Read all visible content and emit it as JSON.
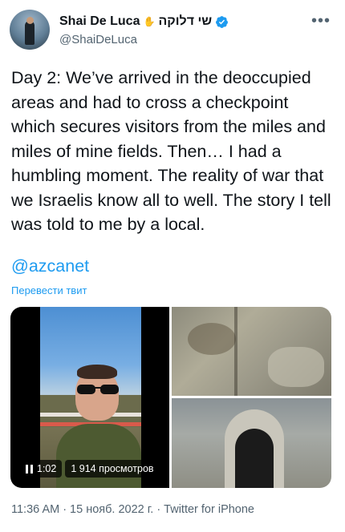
{
  "author": {
    "display_name": "Shai De Luca",
    "hebrew_name": "שי דלוקה",
    "handle": "@ShaiDeLuca",
    "verified": true,
    "avatar_icon": "profile-photo"
  },
  "menu_icon": "more-horizontal-icon",
  "tweet": {
    "text": "Day 2: We’ve arrived in the deoccupied areas and had to cross a checkpoint which secures visitors from the miles and miles of mine fields. Then… I had a humbling moment. The reality of war that we Israelis know all to well. The story I tell was told to me by a local.",
    "mention": "@azcanet",
    "translate_label": "Перевести твит"
  },
  "media": {
    "video": {
      "duration": "1:02",
      "views": "1 914 просмотров",
      "control_icon": "pause-icon"
    },
    "photos": [
      "weathered-wall-photo",
      "stone-doorway-photo"
    ]
  },
  "footer": {
    "time": "11:36 AM",
    "separator": "·",
    "date": "15 нояб. 2022 г.",
    "source": "Twitter for iPhone"
  },
  "colors": {
    "accent": "#1d9bf0",
    "secondary_text": "#536471",
    "primary_text": "#0f1419"
  }
}
